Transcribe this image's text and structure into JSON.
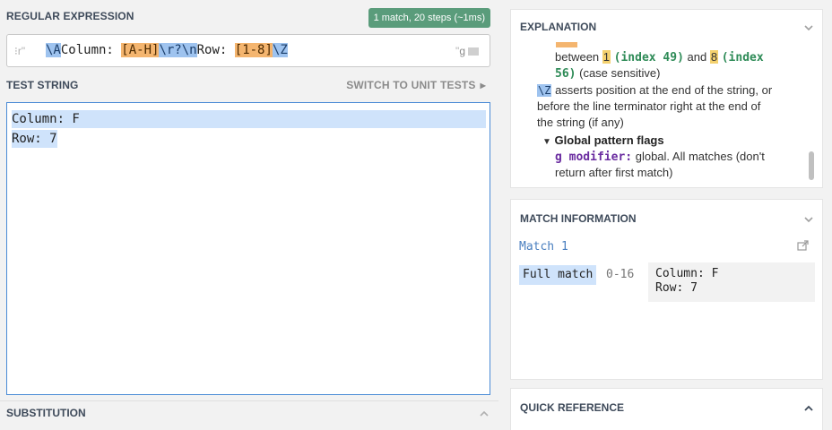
{
  "regex": {
    "title": "REGULAR EXPRESSION",
    "badge": "1 match, 20 steps (~1ms)",
    "prefix": "r\"",
    "tokens": [
      {
        "text": "\\A",
        "kind": "anchor"
      },
      {
        "text": "Column: ",
        "kind": "literal"
      },
      {
        "text": "[A-H]",
        "kind": "class"
      },
      {
        "text": "\\r?\\n",
        "kind": "esc"
      },
      {
        "text": "Row: ",
        "kind": "literal"
      },
      {
        "text": "[1-8]",
        "kind": "class"
      },
      {
        "text": "\\Z",
        "kind": "anchor"
      }
    ],
    "suffix_quote": "\"",
    "flag": "g"
  },
  "test": {
    "title": "TEST STRING",
    "unit_tests_label": "SWITCH TO UNIT TESTS",
    "lines": [
      "Column: F",
      "Row: 7"
    ]
  },
  "substitution": {
    "title": "SUBSTITUTION"
  },
  "explanation": {
    "title": "EXPLANATION",
    "range_prefix": "between",
    "range_low": "1",
    "range_low_index": "(index 49)",
    "range_and": "and",
    "range_high": "8",
    "range_high_index": "(index",
    "range_high_index2": "56)",
    "range_case": "(case sensitive)",
    "z_token": "\\Z",
    "z_desc_1": "asserts position at the end of the string, or",
    "z_desc_2": "before the line terminator right at the end of",
    "z_desc_3": "the string (if any)",
    "flags_title": "Global pattern flags",
    "g_mod": "g modifier:",
    "g_desc_1": "global. All matches (don't",
    "g_desc_2": "return after first match)"
  },
  "match_info": {
    "title": "MATCH INFORMATION",
    "match_label": "Match 1",
    "full_match_label": "Full match",
    "range": "0-16",
    "value": "Column: F\nRow: 7"
  },
  "quick_reference": {
    "title": "QUICK REFERENCE"
  },
  "colors": {
    "accent_green": "#5a9c7b",
    "anchor_blue": "#9ec3ef",
    "class_orange": "#f4b56f",
    "match_highlight": "#cfe3fb",
    "link_blue": "#4a7fbf"
  },
  "icons": [
    "regex-handle-icon",
    "flag-icon",
    "caret-right-icon",
    "chevron-up-icon",
    "chevron-down-icon",
    "share-icon"
  ]
}
